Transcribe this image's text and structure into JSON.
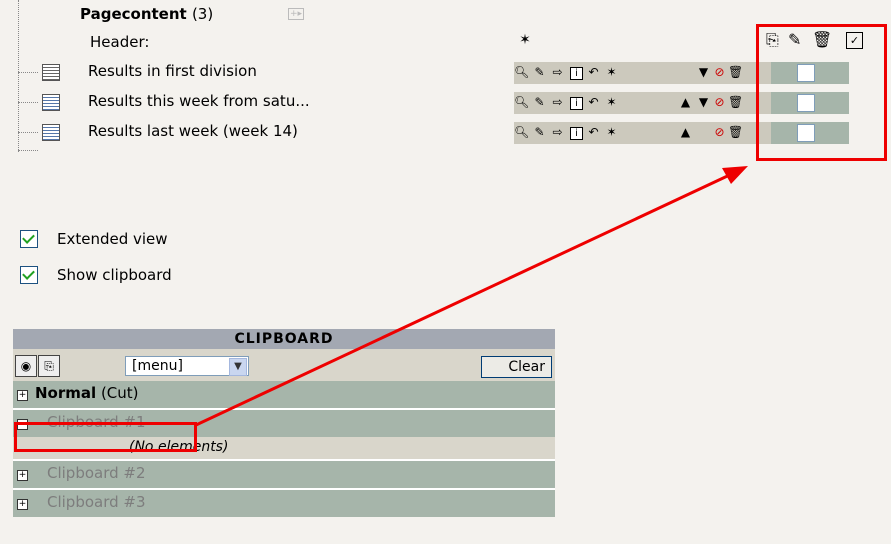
{
  "pagecontent": {
    "title": "Pagecontent",
    "count": "(3)",
    "header_label": "Header:",
    "rows": [
      {
        "title": "Results in first division"
      },
      {
        "title": "Results this week from satu..."
      },
      {
        "title": "Results last week (week 14)"
      }
    ]
  },
  "options": {
    "extended_view": "Extended view",
    "show_clipboard": "Show clipboard"
  },
  "clipboard": {
    "title": "CLIPBOARD",
    "menu_value": "[menu]",
    "clear_label": "Clear",
    "normal_label": "Normal",
    "normal_mode": "(Cut)",
    "pads": [
      "Clipboard #1",
      "Clipboard #2",
      "Clipboard #3"
    ],
    "empty_text": "(No elements)"
  },
  "colors": {
    "highlight": "#ee0000",
    "row_green": "#a6b5aa",
    "action_beige": "#ccc9bd",
    "header_gray": "#a3a8b2"
  },
  "icons": [
    "zoom-icon",
    "edit-icon",
    "move-icon",
    "info-icon",
    "history-icon",
    "new-icon",
    "move-up-icon",
    "move-down-icon",
    "hide-icon",
    "delete-icon",
    "copy-icon",
    "delete-all-icon",
    "select-all-icon"
  ]
}
